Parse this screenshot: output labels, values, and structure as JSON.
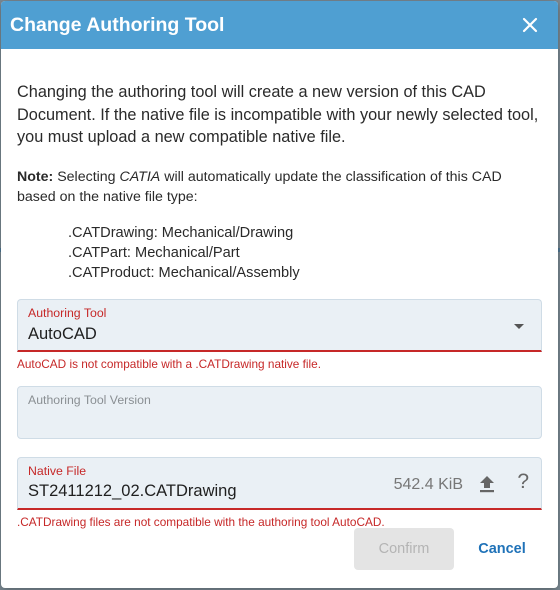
{
  "dialog": {
    "title": "Change Authoring Tool",
    "close_icon": "close-icon",
    "intro": "Changing the authoring tool will create a new version of this CAD Document. If the native file is incompatible with your newly selected tool, you must upload a new compatible native file.",
    "note": {
      "label": "Note:",
      "text_before": " Selecting ",
      "catia": "CATIA",
      "text_after": " will automatically update the classification of this CAD based on the native file type:"
    },
    "extensions": [
      ".CATDrawing: Mechanical/Drawing",
      ".CATPart: Mechanical/Part",
      ".CATProduct: Mechanical/Assembly"
    ],
    "authoring_tool": {
      "label": "Authoring Tool",
      "value": "AutoCAD",
      "error": "AutoCAD is not compatible with a .CATDrawing native file."
    },
    "authoring_tool_version": {
      "label": "Authoring Tool Version",
      "value": ""
    },
    "native_file": {
      "label": "Native File",
      "value": "ST2411212_02.CATDrawing",
      "size": "542.4 KiB",
      "upload_icon": "upload-icon",
      "help": "?",
      "error": ".CATDrawing files are not compatible with the authoring tool AutoCAD."
    },
    "buttons": {
      "confirm": "Confirm",
      "cancel": "Cancel"
    }
  },
  "colors": {
    "header": "#4f9fd2",
    "error": "#c62828",
    "link": "#1f72b8"
  }
}
